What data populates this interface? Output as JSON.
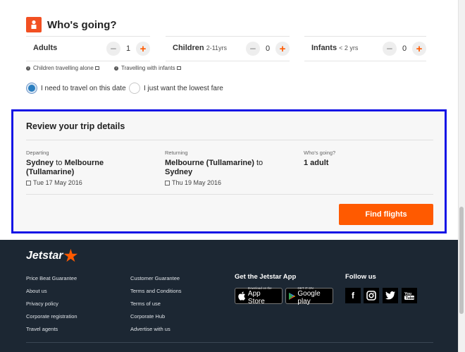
{
  "whos_going": {
    "title": "Who's going?",
    "adults": {
      "label": "Adults",
      "sub": "",
      "value": "1"
    },
    "children": {
      "label": "Children",
      "sub": "2-11yrs",
      "value": "0"
    },
    "infants": {
      "label": "Infants",
      "sub": "< 2 yrs",
      "value": "0"
    },
    "info_links": [
      "Children travelling alone",
      "Travelling with infants"
    ],
    "radio_options": [
      {
        "label": "I need to travel on this date",
        "checked": true
      },
      {
        "label": "I just want the lowest fare",
        "checked": false
      }
    ]
  },
  "review": {
    "title": "Review your trip details",
    "departing": {
      "label": "Departing",
      "from": "Sydney",
      "to_word": "to",
      "to": "Melbourne (Tullamarine)",
      "date": "Tue 17 May 2016"
    },
    "returning": {
      "label": "Returning",
      "from": "Melbourne (Tullamarine)",
      "to_word": "to",
      "to": "Sydney",
      "date": "Thu 19 May 2016"
    },
    "passengers": {
      "label": "Who's going?",
      "value": "1 adult"
    },
    "find_button": "Find flights"
  },
  "footer": {
    "logo": "Jetstar",
    "col1": [
      "Price Beat Guarantee",
      "About us",
      "Privacy policy",
      "Corporate registration",
      "Travel agents"
    ],
    "col2": [
      "Customer Guarantee",
      "Terms and Conditions",
      "Terms of use",
      "Corporate Hub",
      "Advertise with us"
    ],
    "app_heading": "Get the Jetstar App",
    "app_store": {
      "small": "Download on the",
      "big": "App Store"
    },
    "google_play": {
      "small": "GET IT ON",
      "big": "Google play"
    },
    "follow_heading": "Follow us",
    "social_icons": [
      "facebook-icon",
      "instagram-icon",
      "twitter-icon",
      "youtube-icon"
    ]
  },
  "colors": {
    "accent": "#ff5a00",
    "footer_bg": "#1c2733",
    "highlight": "#1414e6",
    "radio": "#2a7ebf"
  }
}
